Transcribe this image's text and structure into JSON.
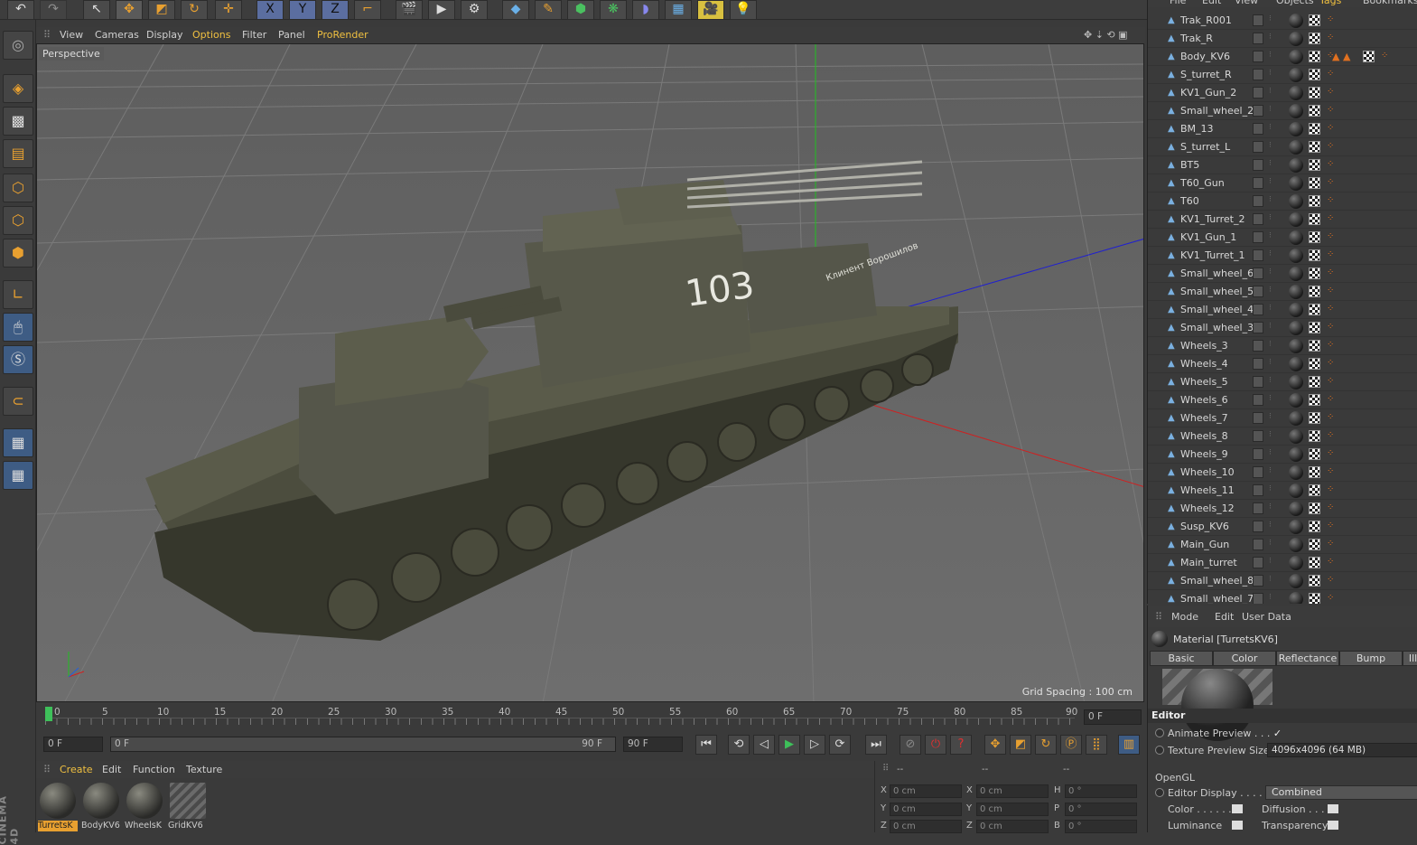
{
  "toolbar": {
    "axes": [
      "X",
      "Y",
      "Z"
    ]
  },
  "viewport": {
    "menu": [
      "View",
      "Cameras",
      "Display",
      "Options",
      "Filter",
      "Panel",
      "ProRender"
    ],
    "label": "Perspective",
    "grid_spacing": "Grid Spacing : 100 cm",
    "hull_number": "103",
    "hull_text": "Клинент Ворошилов"
  },
  "timeline": {
    "ticks": [
      "0",
      "5",
      "10",
      "15",
      "20",
      "25",
      "30",
      "35",
      "40",
      "45",
      "50",
      "55",
      "60",
      "65",
      "70",
      "75",
      "80",
      "85",
      "90"
    ],
    "current": "0 F"
  },
  "transport": {
    "start": "0 F",
    "range_start": "0 F",
    "range_end": "90 F",
    "end": "90 F"
  },
  "materials": {
    "menu": [
      "Create",
      "Edit",
      "Function",
      "Texture"
    ],
    "items": [
      "TurretsK",
      "BodyKV6",
      "WheelsK",
      "GridKV6"
    ]
  },
  "coords": {
    "headers": [
      "--",
      "--",
      "--"
    ],
    "rows": [
      {
        "a": "X",
        "av": "0 cm",
        "b": "X",
        "bv": "0 cm",
        "c": "H",
        "cv": "0 °"
      },
      {
        "a": "Y",
        "av": "0 cm",
        "b": "Y",
        "bv": "0 cm",
        "c": "P",
        "cv": "0 °"
      },
      {
        "a": "Z",
        "av": "0 cm",
        "b": "Z",
        "bv": "0 cm",
        "c": "B",
        "cv": "0 °"
      }
    ]
  },
  "objects": {
    "menu": [
      "File",
      "Edit",
      "View",
      "Objects",
      "Tags",
      "Bookmarks"
    ],
    "items": [
      "Trak_R001",
      "Trak_R",
      "Body_KV6",
      "S_turret_R",
      "KV1_Gun_2",
      "Small_wheel_2",
      "BM_13",
      "S_turret_L",
      "BT5",
      "T60_Gun",
      "T60",
      "KV1_Turret_2",
      "KV1_Gun_1",
      "KV1_Turret_1",
      "Small_wheel_6",
      "Small_wheel_5",
      "Small_wheel_4",
      "Small_wheel_3",
      "Wheels_3",
      "Wheels_4",
      "Wheels_5",
      "Wheels_6",
      "Wheels_7",
      "Wheels_8",
      "Wheels_9",
      "Wheels_10",
      "Wheels_11",
      "Wheels_12",
      "Susp_KV6",
      "Main_Gun",
      "Main_turret",
      "Small_wheel_8",
      "Small_wheel_7"
    ]
  },
  "attributes": {
    "menu": [
      "Mode",
      "Edit",
      "User Data"
    ],
    "title": "Material [TurretsKV6]",
    "tabs": [
      "Basic",
      "Color",
      "Reflectance",
      "Bump",
      "Illu"
    ],
    "section_editor": "Editor",
    "animate_preview": "Animate Preview . . .",
    "animate_check": "✓",
    "texture_preview_label": "Texture Preview Size",
    "texture_preview_value": "4096x4096 (64 MB)",
    "section_opengl": "OpenGL",
    "editor_display_label": "Editor Display . . . . .",
    "editor_display_value": "Combined",
    "color": "Color . . . . . .",
    "diffusion": "Diffusion . . .",
    "luminance": "Luminance",
    "transparency": "Transparency"
  },
  "brand": "CINEMA 4D"
}
